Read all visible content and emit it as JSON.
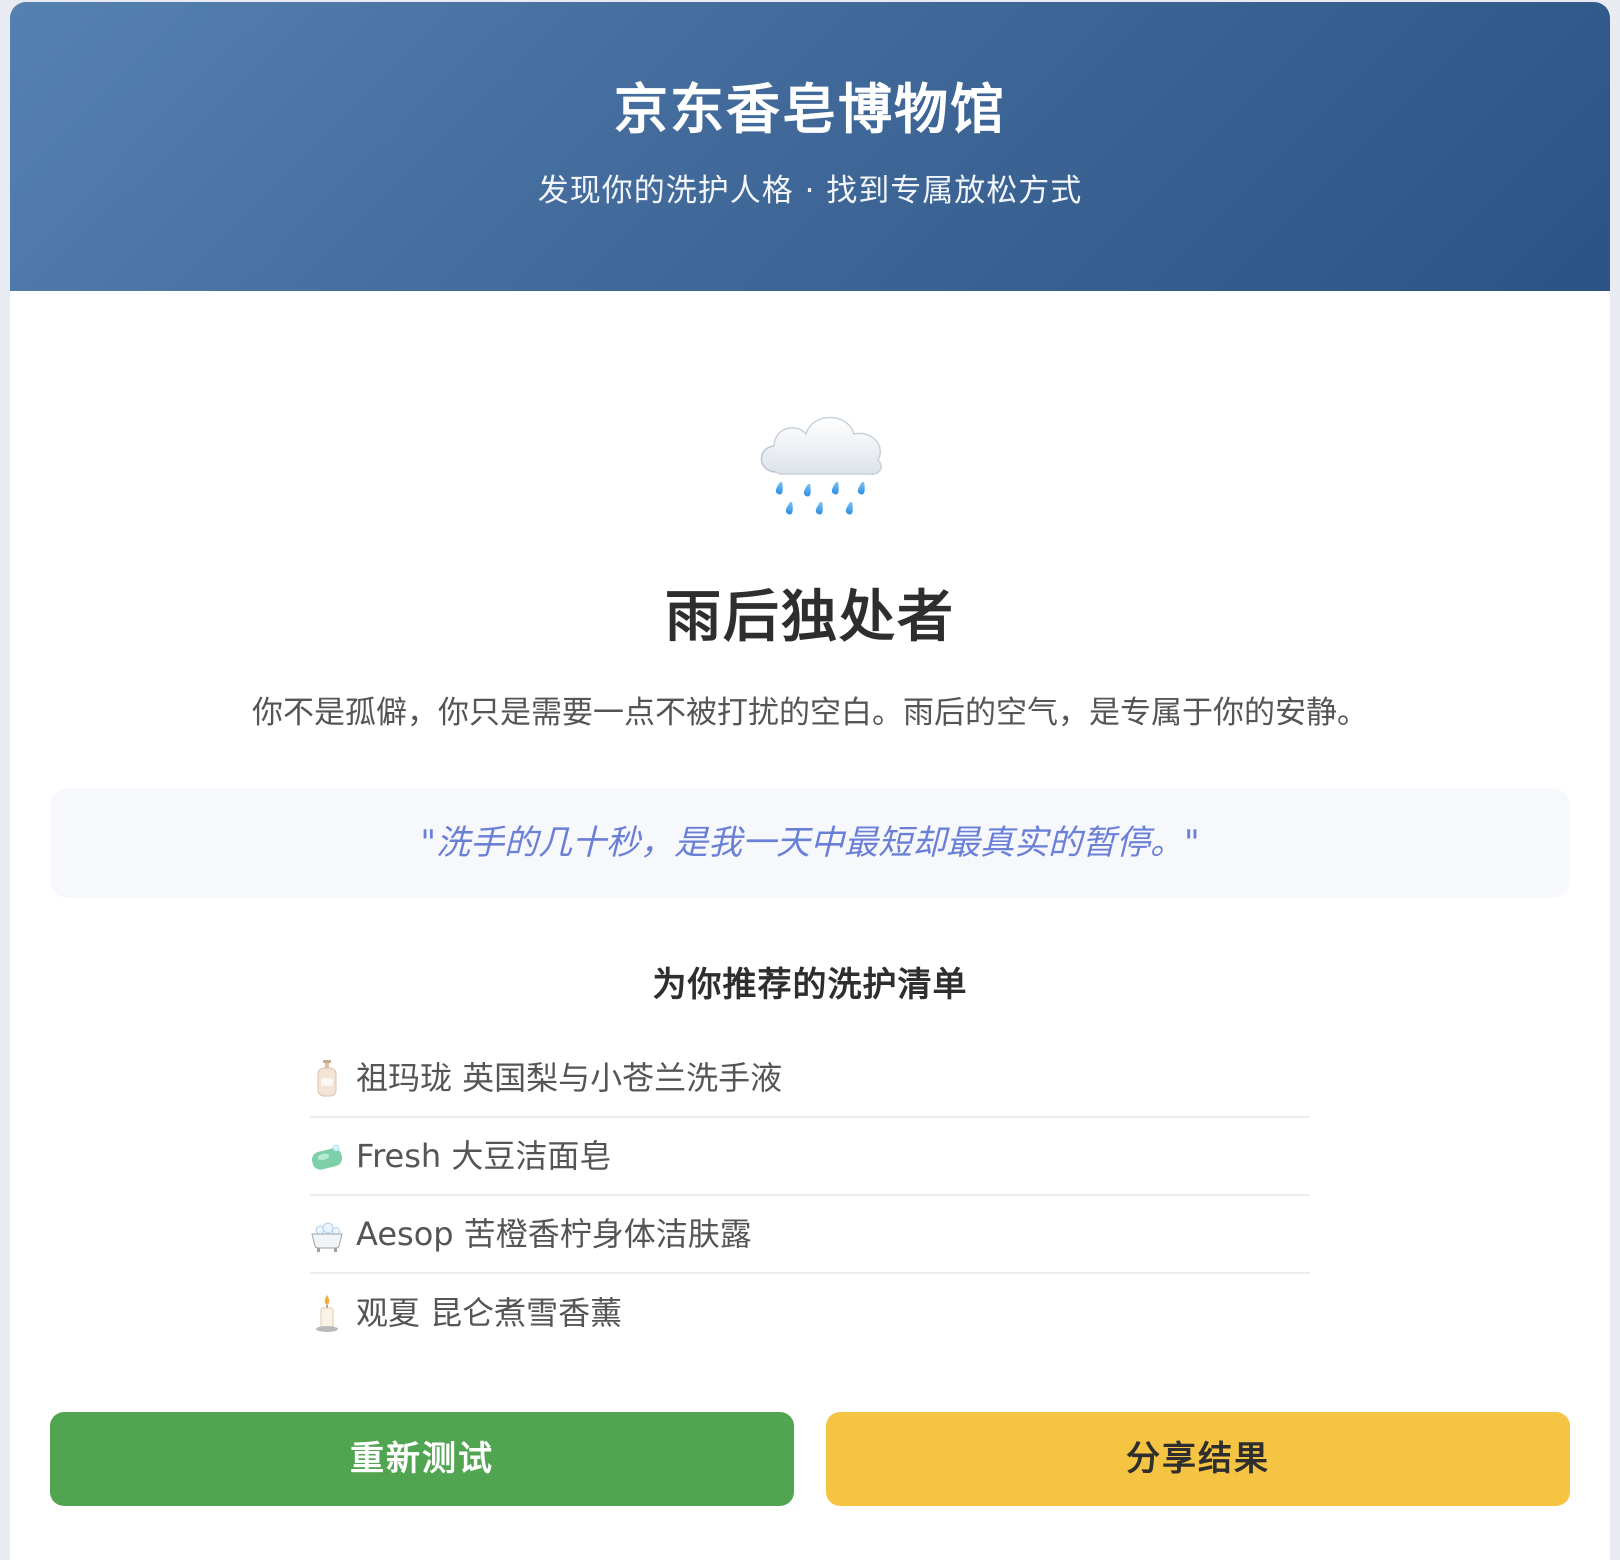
{
  "header": {
    "title": "京东香皂博物馆",
    "subtitle": "发现你的洗护人格 · 找到专属放松方式"
  },
  "result": {
    "icon": "rain-cloud-icon",
    "title": "雨后独处者",
    "description": "你不是孤僻，你只是需要一点不被打扰的空白。雨后的空气，是专属于你的安静。",
    "quote": "\"洗手的几十秒，是我一天中最短却最真实的暂停。\""
  },
  "recommendations": {
    "title": "为你推荐的洗护清单",
    "items": [
      {
        "icon": "lotion-bottle-icon",
        "label": "祖玛珑 英国梨与小苍兰洗手液"
      },
      {
        "icon": "soap-icon",
        "label": "Fresh 大豆洁面皂"
      },
      {
        "icon": "bathtub-icon",
        "label": "Aesop 苦橙香柠身体洁肤露"
      },
      {
        "icon": "candle-icon",
        "label": "观夏 昆仑煮雪香薰"
      }
    ]
  },
  "actions": {
    "retest_label": "重新测试",
    "share_label": "分享结果"
  },
  "colors": {
    "header_gradient_start": "#5581b1",
    "header_gradient_end": "#2b5383",
    "quote_text": "#6a7fd6",
    "retest_button": "#52a550",
    "share_button": "#f5c443"
  }
}
